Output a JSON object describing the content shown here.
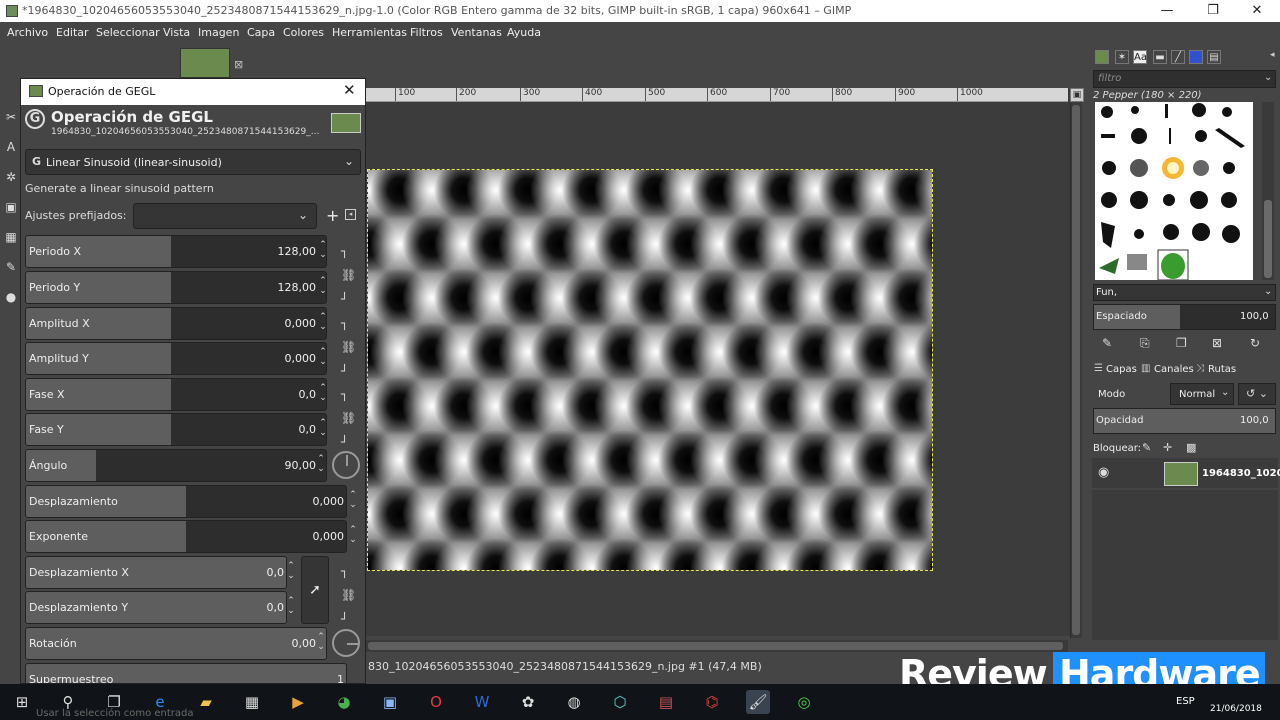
{
  "window": {
    "title": "*1964830_10204656053553040_2523480871544153629_n.jpg-1.0 (Color RGB Entero gamma de 32 bits, GIMP built-in sRGB, 1 capa) 960x641 – GIMP",
    "minimize": "—",
    "restore": "❐",
    "close": "✕"
  },
  "menu": [
    "Archivo",
    "Editar",
    "Seleccionar",
    "Vista",
    "Imagen",
    "Capa",
    "Colores",
    "Herramientas",
    "Filtros",
    "Ventanas",
    "Ayuda"
  ],
  "image_tab": {
    "close": "⊠"
  },
  "ruler": {
    "ticks": [
      "100",
      "200",
      "300",
      "400",
      "500",
      "600",
      "700",
      "800",
      "900",
      "1000"
    ]
  },
  "status": {
    "text": "830_10204656053553040_2523480871544153629_n.jpg #1 (47,4 MB)"
  },
  "dialog": {
    "window_title": "Operación de GEGL",
    "close": "✕",
    "heading": "Operación de GEGL",
    "subheading": "1964830_10204656053553040_2523480871544153629_...",
    "operation": "Linear Sinusoid (linear-sinusoid)",
    "description": "Generate a linear sinusoid pattern",
    "presets_label": "Ajustes prefijados:",
    "params": [
      {
        "label": "Periodo X",
        "value": "128,00"
      },
      {
        "label": "Periodo Y",
        "value": "128,00"
      },
      {
        "label": "Amplitud X",
        "value": "0,000"
      },
      {
        "label": "Amplitud Y",
        "value": "0,000"
      },
      {
        "label": "Fase X",
        "value": "0,0"
      },
      {
        "label": "Fase Y",
        "value": "0,0"
      },
      {
        "label": "Ángulo",
        "value": "90,00"
      },
      {
        "label": "Desplazamiento",
        "value": "0,000"
      },
      {
        "label": "Exponente",
        "value": "0,000"
      },
      {
        "label": "Desplazamiento X",
        "value": "0,0"
      },
      {
        "label": "Desplazamiento Y",
        "value": "0,0"
      },
      {
        "label": "Rotación",
        "value": "0,00"
      },
      {
        "label": "Supermuestreo",
        "value": "1"
      }
    ]
  },
  "dock": {
    "filter_placeholder": "filtro",
    "brush_name": "2 Pepper (180 × 220)",
    "brush_tag": "Fun,",
    "spacing_label": "Espaciado",
    "spacing_value": "100,0",
    "tabs": [
      "Capas",
      "Canales",
      "Rutas"
    ],
    "mode_label": "Modo",
    "mode_value": "Normal",
    "opacity_label": "Opacidad",
    "opacity_value": "100,0",
    "lock_label": "Bloquear:",
    "layer_name": "1964830_1020"
  },
  "watermark": {
    "word1": "Review",
    "word2": "Hardware"
  },
  "taskbar": {
    "lang": "ESP",
    "date": "21/06/2018",
    "hidden_text": "Usar la selección como entrada"
  },
  "colors": {
    "background": "#454545",
    "accent": "#1e90ff",
    "selection": "#e8e84a"
  }
}
